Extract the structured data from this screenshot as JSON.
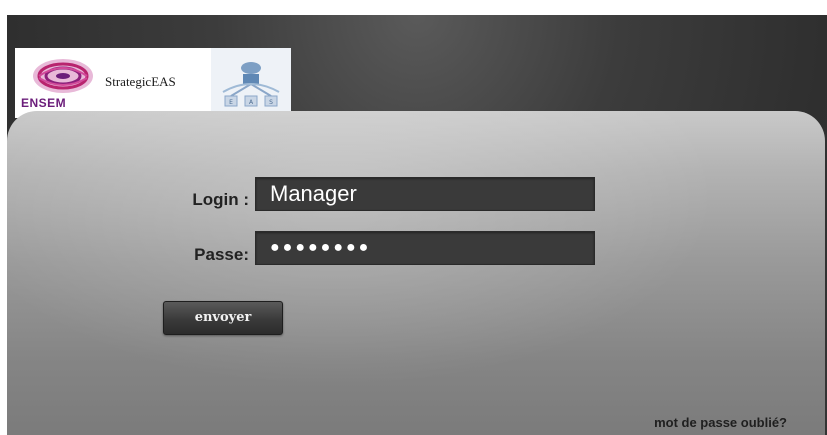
{
  "header": {
    "ensem_logo_text": "ENSEM",
    "strategic_title": "StrategicEAS",
    "eas_logo_letters": [
      "E",
      "A",
      "S"
    ]
  },
  "form": {
    "login_label": "Login :",
    "login_value": "Manager",
    "password_label": "Passe:",
    "password_value": "●●●●●●●●",
    "submit_label": "envoyer",
    "forgot_label": "mot de passe oublié?"
  },
  "colors": {
    "background": "#3c3c3c",
    "panel_top": "#c9c9c9",
    "panel_bottom": "#7a7a7a",
    "input_bg": "#3a3a3a",
    "ensem_purple": "#6b1d7a"
  }
}
